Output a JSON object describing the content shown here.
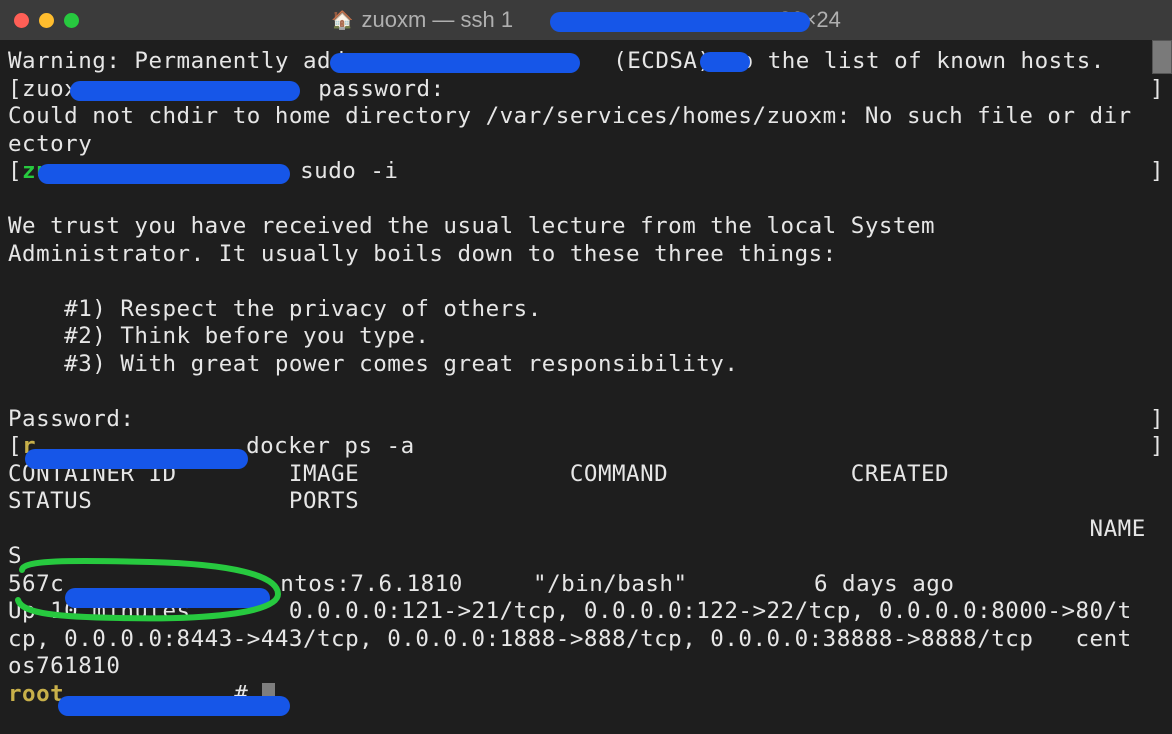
{
  "window": {
    "title_prefix": "zuoxm — ssh 1",
    "title_suffix": "80×24"
  },
  "terminal": {
    "line1a": "Warning: Permanently adde",
    "line1b": " (ECDSA) to the list of known hosts.",
    "line2a": "[zuox",
    "line2b": "password:",
    "line2c": "]",
    "line3": "Could not chdir to home directory /var/services/homes/zuoxm: No such file or dir",
    "line4": "ectory",
    "line5a": "[",
    "line5user": "zu",
    "line5b": "sudo -i",
    "line5c": "]",
    "line6": "",
    "line7": "We trust you have received the usual lecture from the local System",
    "line8": "Administrator. It usually boils down to these three things:",
    "line9": "",
    "line10": "    #1) Respect the privacy of others.",
    "line11": "    #2) Think before you type.",
    "line12": "    #3) With great power comes great responsibility.",
    "line13": "",
    "line14a": "Password:",
    "line14b": "]",
    "line15a": "[",
    "line15user": "r",
    "line15b": "docker ps -a",
    "line15c": "]",
    "line16": "CONTAINER ID        IMAGE               COMMAND             CREATED             ",
    "line17": "STATUS              PORTS                                                        ",
    "line18": "                                                                             NAME",
    "line19": "S",
    "line20a": "567c",
    "line20b": "ntos:7.6.1810     \"/bin/bash\"         6 days ago          ",
    "line21": "Up 10 minutes       0.0.0.0:121->21/tcp, 0.0.0.0:122->22/tcp, 0.0.0.0:8000->80/t",
    "line22": "cp, 0.0.0.0:8443->443/tcp, 0.0.0.0:1888->888/tcp, 0.0.0.0:38888->8888/tcp   cent",
    "line23": "os761810",
    "line24user": "root",
    "line24a": "#"
  }
}
